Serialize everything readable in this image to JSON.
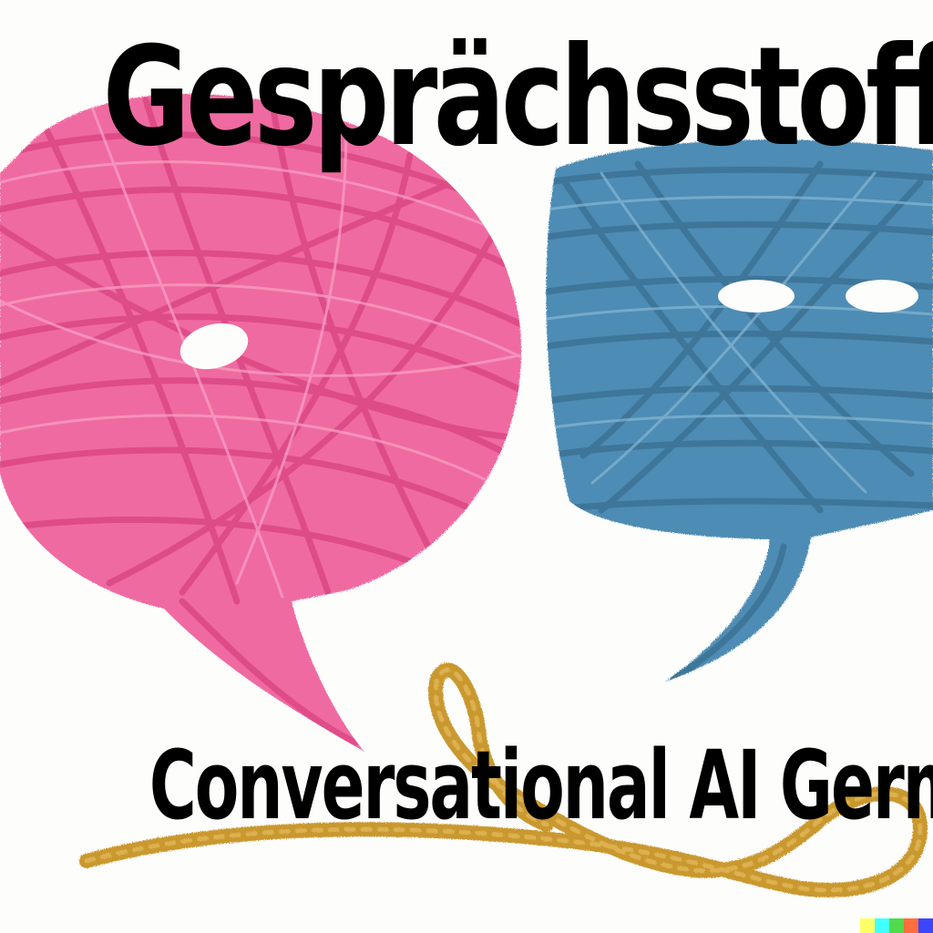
{
  "title": "Gesprächsstoff!",
  "subtitle": "Conversational AI Germany",
  "colors": {
    "pink_yarn": "#ef6aa0",
    "pink_yarn_dark": "#d9437f",
    "blue_yarn": "#4e8cb4",
    "blue_yarn_dark": "#3a6f92",
    "gold_yarn": "#c9982f",
    "text": "#000000",
    "background": "#fdfdfc"
  },
  "signature_colors": [
    "#ffff66",
    "#42ffff",
    "#51da4c",
    "#ff6e3c",
    "#3c46ff"
  ]
}
